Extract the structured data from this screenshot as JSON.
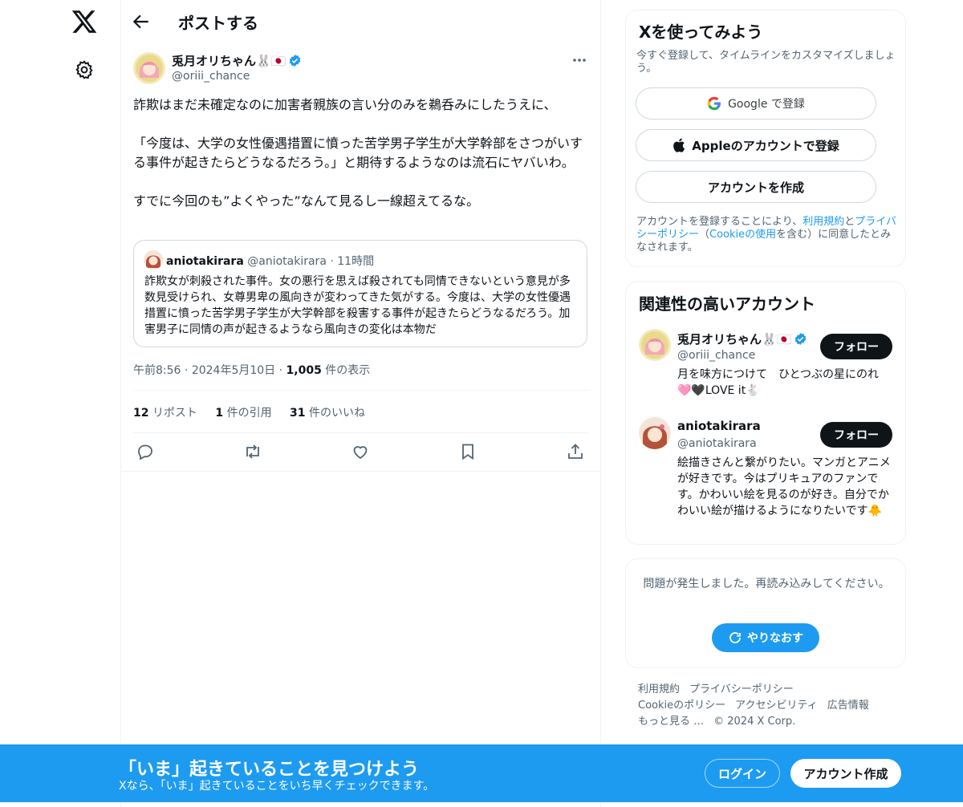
{
  "nav": {
    "logo": "X",
    "settings_icon": "gear-icon"
  },
  "header": {
    "title": "ポストする",
    "back_icon": "arrow-left-icon"
  },
  "post": {
    "author_name": "兎月オリちゃん🐰🇯🇵",
    "author_handle": "@oriii_chance",
    "paragraphs": [
      "詐欺はまだ未確定なのに加害者親族の言い分のみを鵜呑みにしたうえに、",
      "",
      "「今度は、大学の女性優遇措置に憤った苦学男子学生が大学幹部をさつがいする事件が起きたらどうなるだろう。」と期待するようなのは流石にヤバいわ。",
      "",
      "すでに今回のも”よくやった”なんて見るし一線超えてるな。"
    ],
    "quote": {
      "name": "aniotakirara",
      "handle": "@aniotakirara",
      "time": "11時間",
      "text": "詐欺女が刺殺された事件。女の悪行を思えば殺されても同情できないという意見が多数見受けられ、女尊男卑の風向きが変わってきた気がする。今度は、大学の女性優遇措置に憤った苦学男子学生が大学幹部を殺害する事件が起きたらどうなるだろう。加害男子に同情の声が起きるようなら風向きの変化は本物だ"
    },
    "meta": {
      "time": "午前8:56",
      "date": "2024年5月10日",
      "views_count": "1,005",
      "views_label": "件の表示"
    },
    "stats": {
      "reposts_count": "12",
      "reposts_label": "リポスト",
      "quotes_count": "1",
      "quotes_label": "件の引用",
      "likes_count": "31",
      "likes_label": "件のいいね"
    }
  },
  "signup": {
    "title": "Xを使ってみよう",
    "subtitle": "今すぐ登録して、タイムラインをカスタマイズしましょう。",
    "google_label": "Google で登録",
    "apple_label": "Appleのアカウントで登録",
    "create_label": "アカウントを作成",
    "terms_prefix": "アカウントを登録することにより、",
    "terms_link": "利用規約",
    "terms_and": "と",
    "privacy_link": "プライバシーポリシー",
    "terms_mid": "（",
    "cookie_link": "Cookieの使用",
    "terms_suffix": "を含む）に同意したとみなされます。"
  },
  "related": {
    "title": "関連性の高いアカウント",
    "follow_label": "フォロー",
    "accounts": [
      {
        "name": "兎月オリちゃん🐰🇯🇵",
        "handle": "@oriii_chance",
        "bio": "月を味方につけて　ひとつぶの星にのれ🩷🖤LOVE it🐇"
      },
      {
        "name": "aniotakirara",
        "handle": "@aniotakirara",
        "bio": "絵描きさんと繋がりたい。マンガとアニメが好きです。今はプリキュアのファンです。かわいい絵を見るのが好き。自分でかわいい絵が描けるようになりたいです🐥"
      }
    ]
  },
  "error_card": {
    "message": "問題が発生しました。再読み込みしてください。",
    "retry_label": "やりなおす"
  },
  "footer": {
    "links": [
      "利用規約",
      "プライバシーポリシー",
      "Cookieのポリシー",
      "アクセシビリティ",
      "広告情報",
      "もっと見る …"
    ],
    "copyright": "© 2024 X Corp."
  },
  "banner": {
    "title": "「いま」起きていることを見つけよう",
    "subtitle": "Xなら、「いま」起きていることをいち早くチェックできます。",
    "login_label": "ログイン",
    "signup_label": "アカウント作成"
  },
  "colors": {
    "accent": "#1d9bf0",
    "text": "#0f1419",
    "muted": "#536471",
    "verified": "#1d9bf0"
  }
}
